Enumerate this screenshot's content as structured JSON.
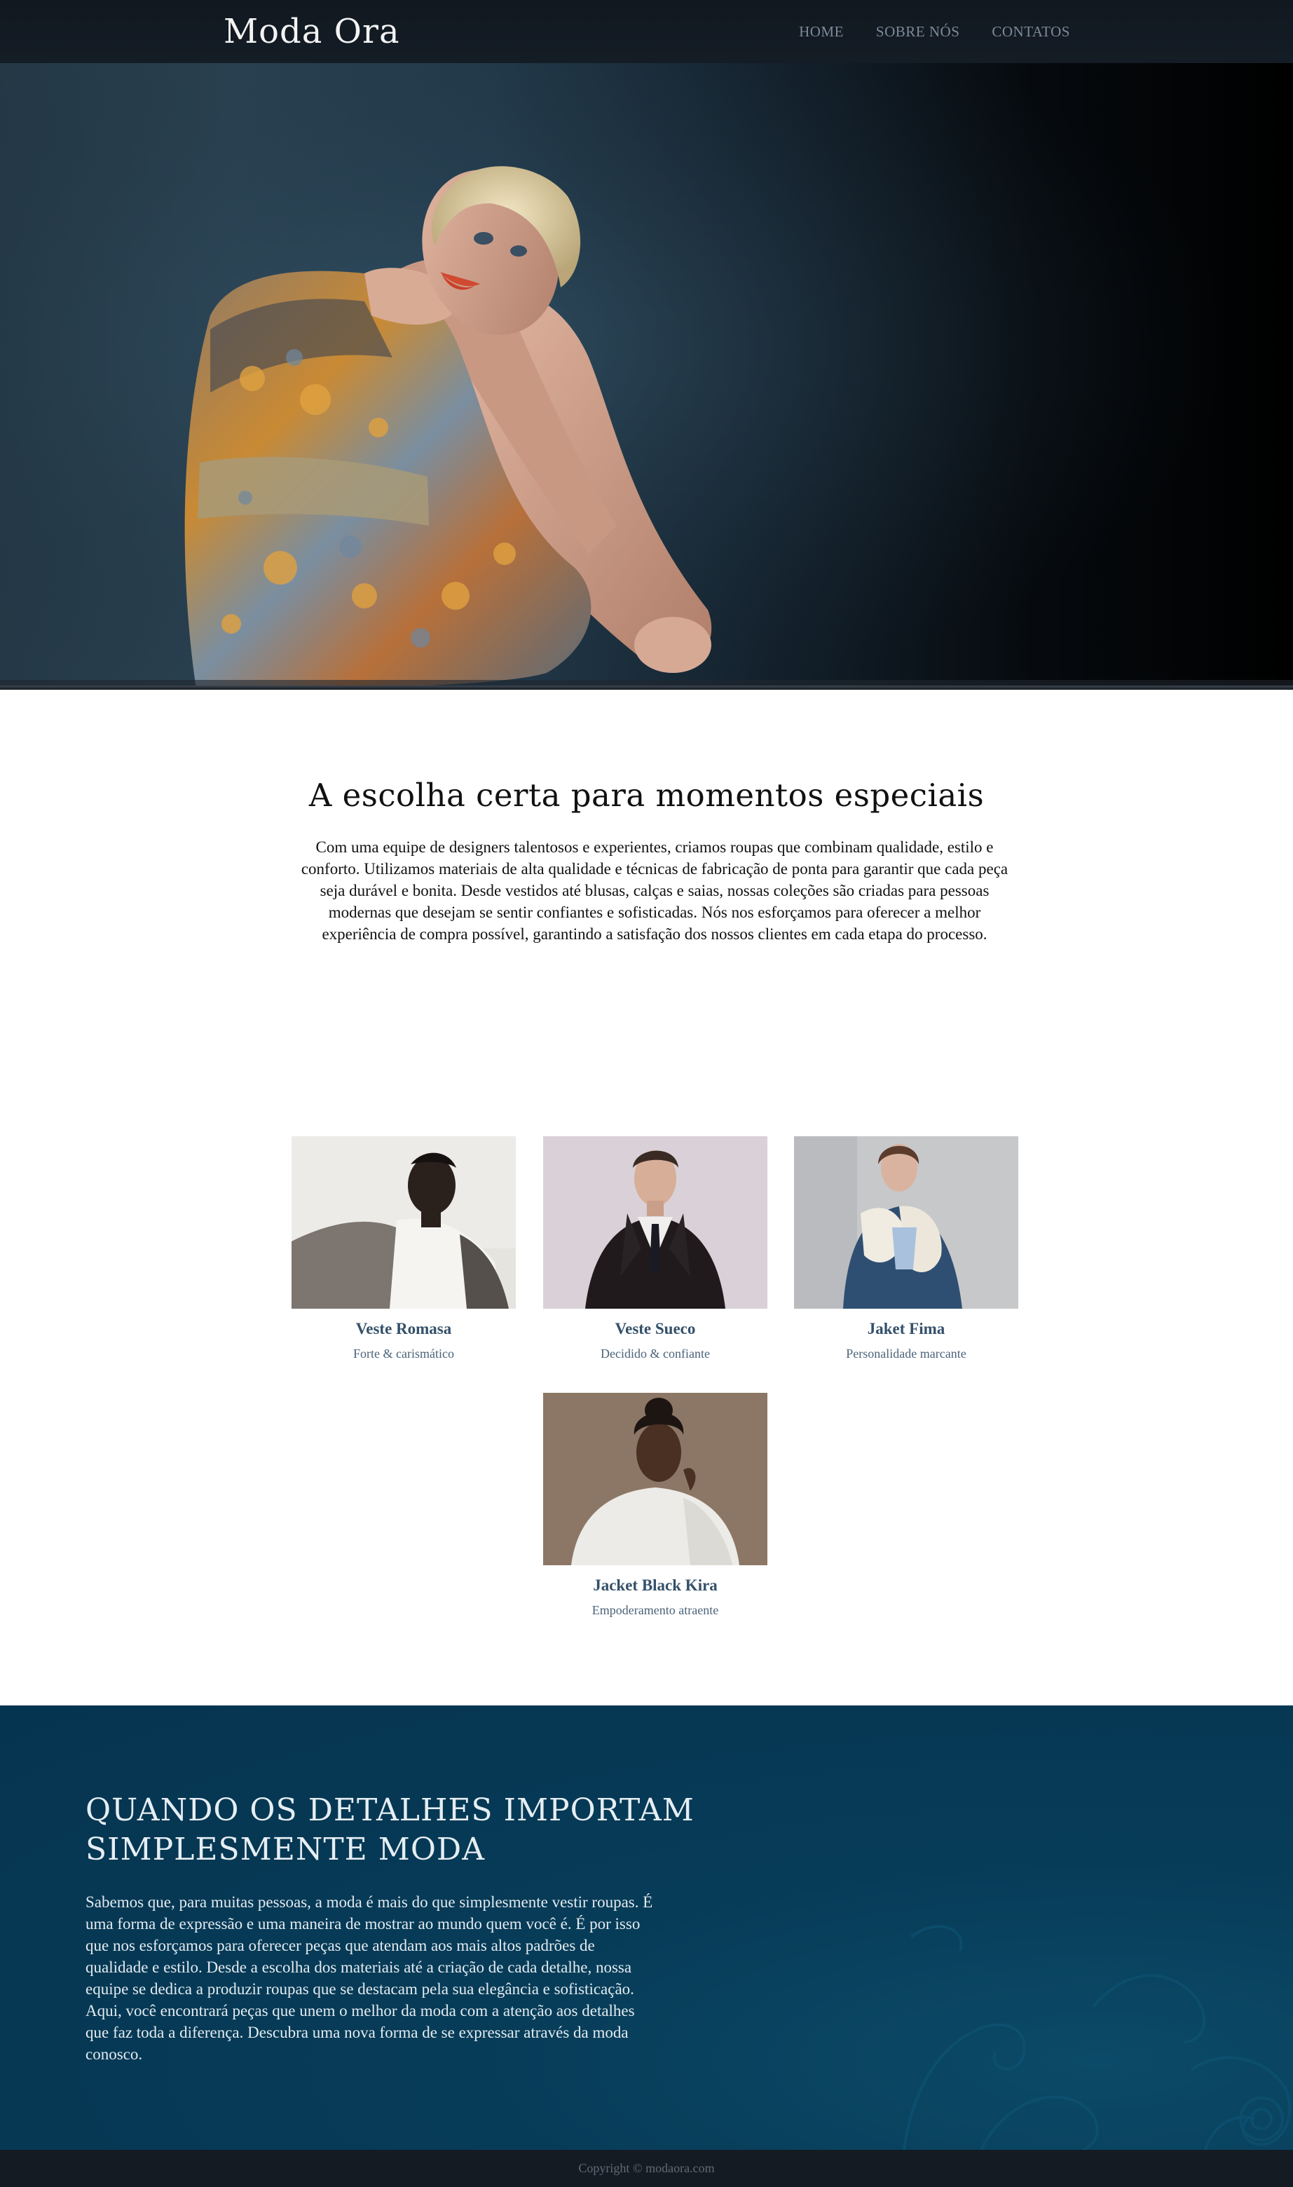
{
  "navbar": {
    "brand": "Moda Ora",
    "links": [
      "HOME",
      "SOBRE NÓS",
      "CONTATOS"
    ]
  },
  "hero": {
    "image": "fashion-model-photo"
  },
  "intro": {
    "title": "A escolha certa para momentos especiais",
    "text": "Com uma equipe de designers talentosos e experientes, criamos roupas que combinam qualidade, estilo e conforto. Utilizamos materiais de alta qualidade e técnicas de fabricação de ponta para garantir que cada peça seja durável e bonita. Desde vestidos até blusas, calças e saias, nossas coleções são criadas para pessoas modernas que desejam se sentir confiantes e sofisticadas. Nós nos esforçamos para oferecer a melhor experiência de compra possível, garantindo a satisfação dos nossos clientes em cada etapa do processo."
  },
  "products": [
    {
      "name": "Veste Romasa",
      "desc": "Forte & carismático"
    },
    {
      "name": "Veste Sueco",
      "desc": "Decidido & confiante"
    },
    {
      "name": "Jaket Fima",
      "desc": "Personalidade marcante"
    },
    {
      "name": "Jacket Black Kira",
      "desc": "Empoderamento atraente"
    }
  ],
  "details": {
    "title": "QUANDO OS DETALHES IMPORTAM\nSIMPLESMENTE MODA",
    "text": "Sabemos que, para muitas pessoas, a moda é mais do que simplesmente vestir roupas. É uma forma de expressão e uma maneira de mostrar ao mundo quem você é. É por isso que nos esforçamos para oferecer peças que atendam aos mais altos padrões de qualidade e estilo. Desde a escolha dos materiais até a criação de cada detalhe, nossa equipe se dedica a produzir roupas que se destacam pela sua elegância e sofisticação. Aqui, você encontrará peças que unem o melhor da moda com a atenção aos detalhes que faz toda a diferença. Descubra uma nova forma de se expressar através da moda conosco."
  },
  "footer": {
    "copyright": "Copyright © modaora.com"
  },
  "colors": {
    "navbar": "#121920",
    "accent": "#34506a",
    "details_bg": "#063751",
    "footer": "#151b22"
  }
}
